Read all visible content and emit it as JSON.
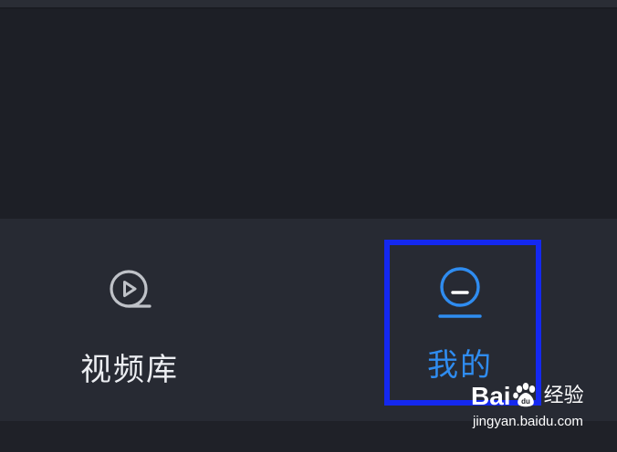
{
  "tab_bar": {
    "tabs": [
      {
        "label": "视频库",
        "icon": "video-library-icon",
        "active": false
      },
      {
        "label": "我的",
        "icon": "profile-icon",
        "active": true
      }
    ]
  },
  "colors": {
    "active": "#2f8cf0",
    "inactive_icon": "#bfc2c8",
    "highlight_box": "#1428f0"
  },
  "watermark": {
    "logo_left": "Bai",
    "logo_right": "du",
    "logo_suffix": "经验",
    "domain": "jingyan.baidu.com"
  }
}
